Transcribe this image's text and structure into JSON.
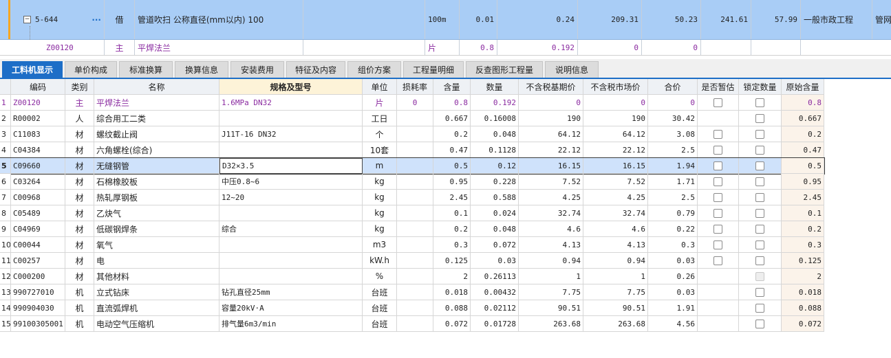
{
  "top": {
    "row1": {
      "code": "5-644",
      "more": "···",
      "type": "借",
      "name": "管道吹扫 公称直径(mm以内) 100",
      "unit": "100m",
      "qty1": "0.01",
      "qty2": "0.24",
      "v1": "209.31",
      "v2": "50.23",
      "v3": "241.61",
      "v4": "57.99",
      "category": "一般市政工程",
      "extra": "管网"
    },
    "row2": {
      "code": "Z00120",
      "type": "主",
      "name": "平焊法兰",
      "unit": "片",
      "qty1": "0.8",
      "qty2": "0.192",
      "v1": "0",
      "v2": "0"
    }
  },
  "tabs": [
    {
      "label": "工料机显示",
      "active": true
    },
    {
      "label": "单价构成"
    },
    {
      "label": "标准换算"
    },
    {
      "label": "换算信息"
    },
    {
      "label": "安装费用"
    },
    {
      "label": "特征及内容"
    },
    {
      "label": "组价方案"
    },
    {
      "label": "工程量明细"
    },
    {
      "label": "反查图形工程量"
    },
    {
      "label": "说明信息"
    }
  ],
  "columns": [
    "编码",
    "类别",
    "名称",
    "规格及型号",
    "单位",
    "损耗率",
    "含量",
    "数量",
    "不含税基期价",
    "不含税市场价",
    "合价",
    "是否暂估",
    "锁定数量",
    "原始含量"
  ],
  "rows": [
    {
      "n": "1",
      "code": "Z00120",
      "cat": "主",
      "name": "平焊法兰",
      "spec": "1.6MPa DN32",
      "unit": "片",
      "loss": "0",
      "content": "0.8",
      "qty": "0.192",
      "base": "0",
      "market": "0",
      "total": "0",
      "est": "cb",
      "lock": "cb",
      "orig": "0.8",
      "main": true
    },
    {
      "n": "2",
      "code": "R00002",
      "cat": "人",
      "name": "综合用工二类",
      "spec": "",
      "unit": "工日",
      "loss": "",
      "content": "0.667",
      "qty": "0.16008",
      "base": "190",
      "market": "190",
      "total": "30.42",
      "est": "",
      "lock": "cb",
      "orig": "0.667"
    },
    {
      "n": "3",
      "code": "C11083",
      "cat": "材",
      "name": "螺纹截止阀",
      "spec": "J11T-16 DN32",
      "unit": "个",
      "loss": "",
      "content": "0.2",
      "qty": "0.048",
      "base": "64.12",
      "market": "64.12",
      "total": "3.08",
      "est": "cb",
      "lock": "cb",
      "orig": "0.2"
    },
    {
      "n": "4",
      "code": "C04384",
      "cat": "材",
      "name": "六角螺栓(综合)",
      "spec": "",
      "unit": "10套",
      "loss": "",
      "content": "0.47",
      "qty": "0.1128",
      "base": "22.12",
      "market": "22.12",
      "total": "2.5",
      "est": "cb",
      "lock": "cb",
      "orig": "0.47"
    },
    {
      "n": "5",
      "code": "C09660",
      "cat": "材",
      "name": "无缝钢管",
      "spec": "D32×3.5",
      "unit": "m",
      "loss": "",
      "content": "0.5",
      "qty": "0.12",
      "base": "16.15",
      "market": "16.15",
      "total": "1.94",
      "est": "cb",
      "lock": "cb",
      "orig": "0.5",
      "sel": true
    },
    {
      "n": "6",
      "code": "C03264",
      "cat": "材",
      "name": "石棉橡胶板",
      "spec": "中压0.8~6",
      "unit": "kg",
      "loss": "",
      "content": "0.95",
      "qty": "0.228",
      "base": "7.52",
      "market": "7.52",
      "total": "1.71",
      "est": "cb",
      "lock": "cb",
      "orig": "0.95"
    },
    {
      "n": "7",
      "code": "C00968",
      "cat": "材",
      "name": "热轧厚钢板",
      "spec": "12~20",
      "unit": "kg",
      "loss": "",
      "content": "2.45",
      "qty": "0.588",
      "base": "4.25",
      "market": "4.25",
      "total": "2.5",
      "est": "cb",
      "lock": "cb",
      "orig": "2.45"
    },
    {
      "n": "8",
      "code": "C05489",
      "cat": "材",
      "name": "乙炔气",
      "spec": "",
      "unit": "kg",
      "loss": "",
      "content": "0.1",
      "qty": "0.024",
      "base": "32.74",
      "market": "32.74",
      "total": "0.79",
      "est": "cb",
      "lock": "cb",
      "orig": "0.1"
    },
    {
      "n": "9",
      "code": "C04969",
      "cat": "材",
      "name": "低碳钢焊条",
      "spec": "综合",
      "unit": "kg",
      "loss": "",
      "content": "0.2",
      "qty": "0.048",
      "base": "4.6",
      "market": "4.6",
      "total": "0.22",
      "est": "cb",
      "lock": "cb",
      "orig": "0.2"
    },
    {
      "n": "10",
      "code": "C00044",
      "cat": "材",
      "name": "氧气",
      "spec": "",
      "unit": "m3",
      "loss": "",
      "content": "0.3",
      "qty": "0.072",
      "base": "4.13",
      "market": "4.13",
      "total": "0.3",
      "est": "cb",
      "lock": "cb",
      "orig": "0.3"
    },
    {
      "n": "11",
      "code": "C00257",
      "cat": "材",
      "name": "电",
      "spec": "",
      "unit": "kW.h",
      "loss": "",
      "content": "0.125",
      "qty": "0.03",
      "base": "0.94",
      "market": "0.94",
      "total": "0.03",
      "est": "cb",
      "lock": "cb",
      "orig": "0.125"
    },
    {
      "n": "12",
      "code": "C000200",
      "cat": "材",
      "name": "其他材料",
      "spec": "",
      "unit": "%",
      "loss": "",
      "content": "2",
      "qty": "0.26113",
      "base": "1",
      "market": "1",
      "total": "0.26",
      "est": "",
      "lock": "dis",
      "orig": "2"
    },
    {
      "n": "13",
      "code": "990727010",
      "cat": "机",
      "name": "立式钻床",
      "spec": "钻孔直径25mm",
      "unit": "台班",
      "loss": "",
      "content": "0.018",
      "qty": "0.00432",
      "base": "7.75",
      "market": "7.75",
      "total": "0.03",
      "est": "",
      "lock": "cb",
      "orig": "0.018"
    },
    {
      "n": "14",
      "code": "990904030",
      "cat": "机",
      "name": "直流弧焊机",
      "spec": "容量20kV·A",
      "unit": "台班",
      "loss": "",
      "content": "0.088",
      "qty": "0.02112",
      "base": "90.51",
      "market": "90.51",
      "total": "1.91",
      "est": "",
      "lock": "cb",
      "orig": "0.088"
    },
    {
      "n": "15",
      "code": "99100305001",
      "cat": "机",
      "name": "电动空气压缩机",
      "spec": "排气量6m3/min",
      "unit": "台班",
      "loss": "",
      "content": "0.072",
      "qty": "0.01728",
      "base": "263.68",
      "market": "263.68",
      "total": "4.56",
      "est": "",
      "lock": "cb",
      "orig": "0.072"
    }
  ]
}
